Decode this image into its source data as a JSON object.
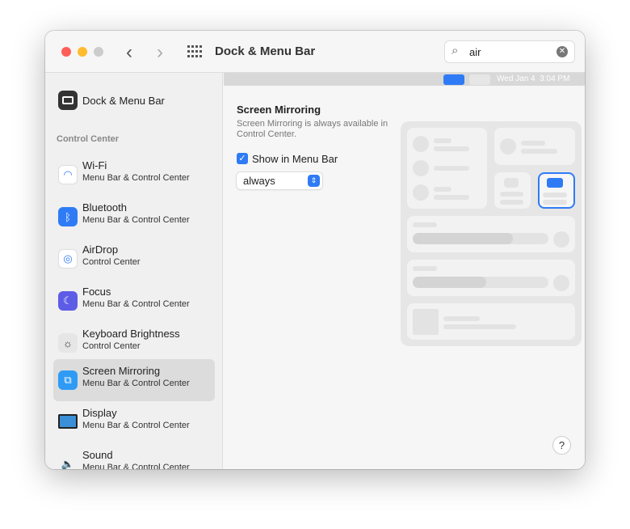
{
  "window": {
    "title": "Dock & Menu Bar"
  },
  "search": {
    "value": "air"
  },
  "sidebar": {
    "top": {
      "label": "Dock & Menu Bar"
    },
    "section": "Control Center",
    "items": [
      {
        "label": "Wi-Fi",
        "sub": "Menu Bar & Control Center"
      },
      {
        "label": "Bluetooth",
        "sub": "Menu Bar & Control Center"
      },
      {
        "label": "AirDrop",
        "sub": "Control Center"
      },
      {
        "label": "Focus",
        "sub": "Menu Bar & Control Center"
      },
      {
        "label": "Keyboard Brightness",
        "sub": "Control Center"
      },
      {
        "label": "Screen Mirroring",
        "sub": "Menu Bar & Control Center"
      },
      {
        "label": "Display",
        "sub": "Menu Bar & Control Center"
      },
      {
        "label": "Sound",
        "sub": "Menu Bar & Control Center"
      }
    ]
  },
  "main": {
    "menubar_clock": "Wed Jan 4  3:04 PM",
    "heading": "Screen Mirroring",
    "desc": "Screen Mirroring is always available in Control Center.",
    "checkbox": {
      "label": "Show in Menu Bar",
      "checked": true
    },
    "select": {
      "value": "always"
    },
    "help": "?"
  },
  "colors": {
    "accent": "#2f7bf5"
  }
}
